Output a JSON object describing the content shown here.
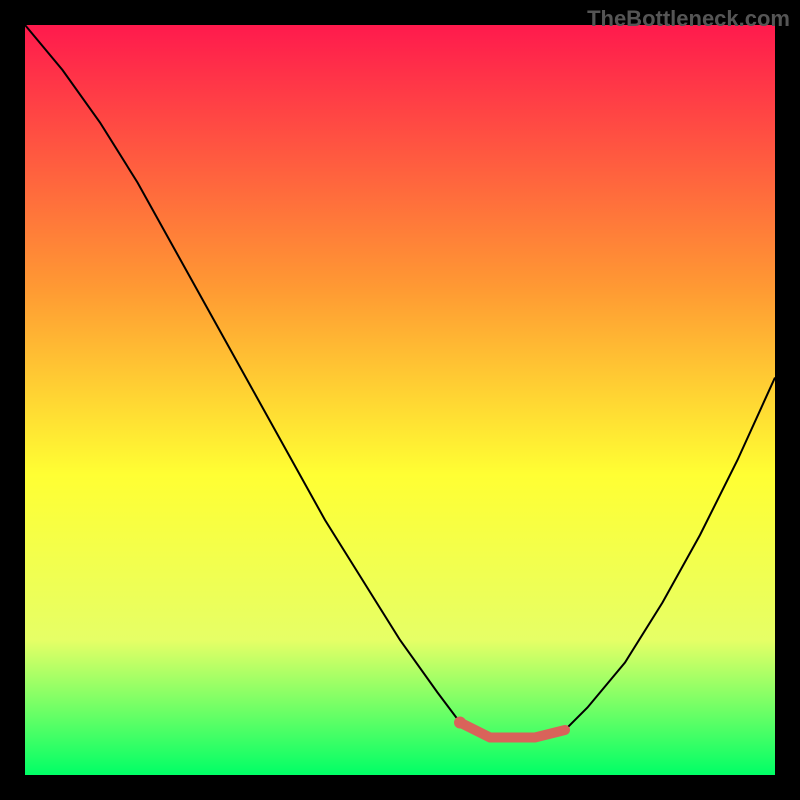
{
  "watermark": "TheBottleneck.com",
  "chart_data": {
    "type": "line",
    "title": "",
    "xlabel": "",
    "ylabel": "",
    "xlim": [
      0,
      100
    ],
    "ylim": [
      0,
      100
    ],
    "background_gradient": {
      "top": "#ff1a4d",
      "mid_upper": "#ff9933",
      "mid": "#ffff33",
      "mid_lower": "#e6ff66",
      "bottom": "#00ff66"
    },
    "series": [
      {
        "name": "curve",
        "color": "#000000",
        "x": [
          0,
          5,
          10,
          15,
          20,
          25,
          30,
          35,
          40,
          45,
          50,
          55,
          58,
          62,
          68,
          72,
          75,
          80,
          85,
          90,
          95,
          100
        ],
        "y": [
          100,
          94,
          87,
          79,
          70,
          61,
          52,
          43,
          34,
          26,
          18,
          11,
          7,
          5,
          5,
          6,
          9,
          15,
          23,
          32,
          42,
          53
        ]
      },
      {
        "name": "highlight",
        "color": "#d9635a",
        "x": [
          58,
          60,
          62,
          64,
          66,
          68,
          70,
          72
        ],
        "y": [
          7,
          6,
          5,
          5,
          5,
          5,
          5.5,
          6
        ]
      }
    ],
    "marker": {
      "x": 58,
      "y": 7,
      "color": "#d9635a"
    }
  },
  "colors": {
    "frame": "#000000",
    "watermark": "#555555"
  }
}
